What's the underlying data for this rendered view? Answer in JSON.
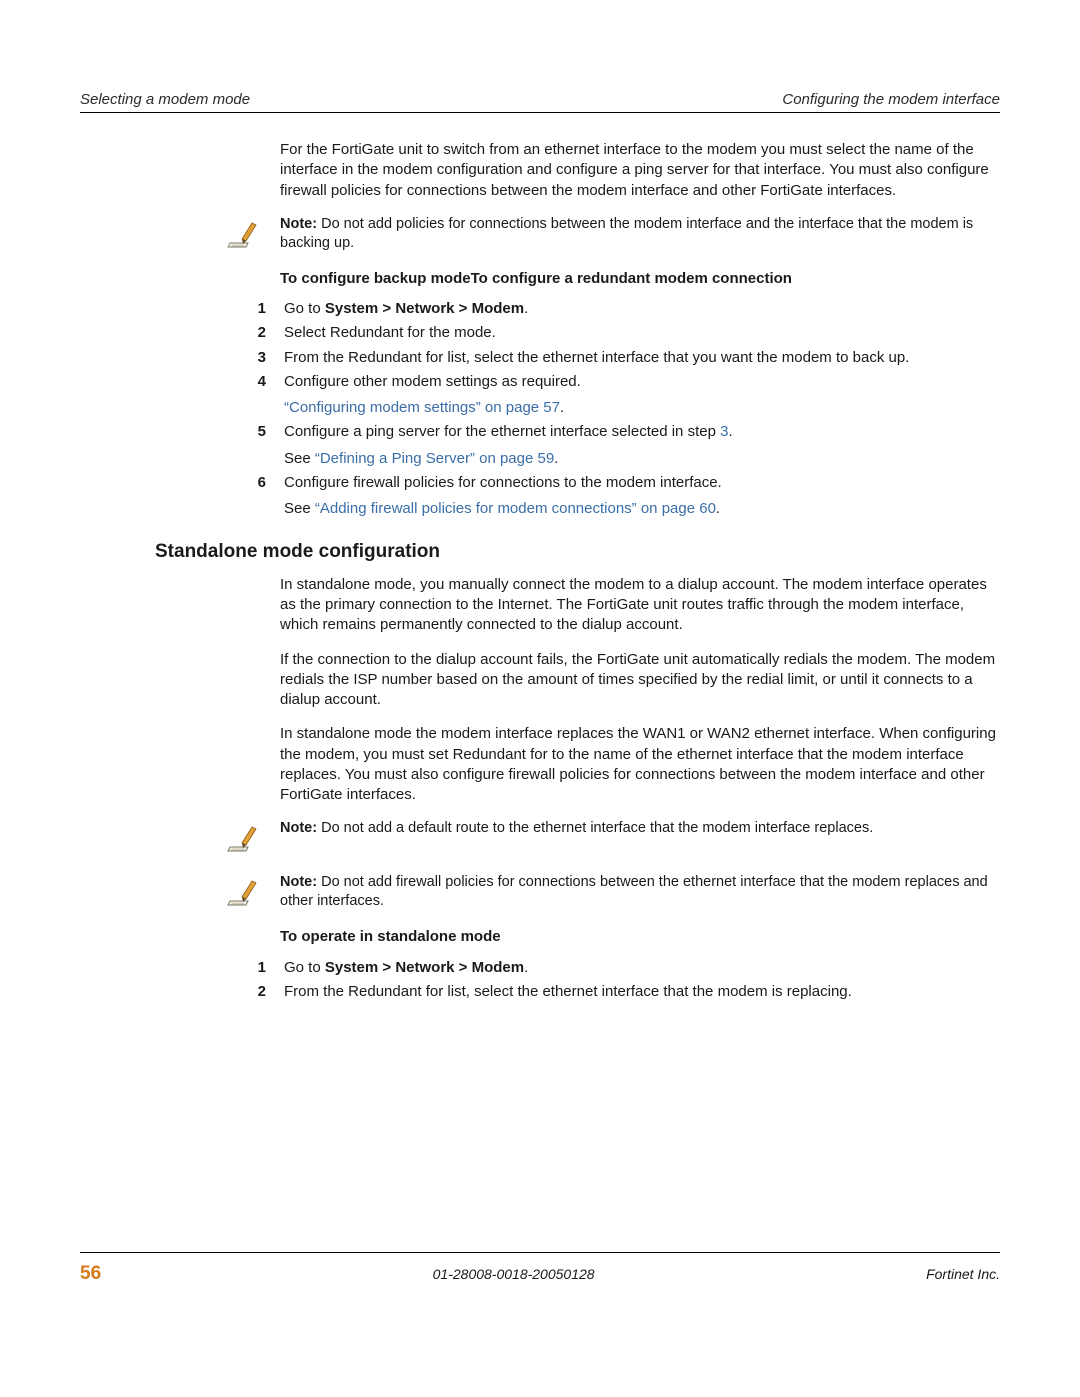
{
  "header": {
    "left": "Selecting a modem mode",
    "right": "Configuring the modem interface"
  },
  "intro": "For the FortiGate unit to switch from an ethernet interface to the modem you must select the name of the interface in the modem configuration and configure a ping server for that interface. You must also configure firewall policies for connections between the modem interface and other FortiGate interfaces.",
  "note1": {
    "label": "Note:",
    "text": " Do not add policies for connections between the modem interface and the interface that the modem is backing up."
  },
  "proc1": {
    "title": "To configure backup modeTo configure a redundant modem connection",
    "steps": [
      {
        "n": "1",
        "pre": "Go to ",
        "bold": "System > Network > Modem",
        "post": "."
      },
      {
        "n": "2",
        "text": "Select Redundant for the mode."
      },
      {
        "n": "3",
        "text": "From the Redundant for list, select the ethernet interface that you want the modem to back up."
      },
      {
        "n": "4",
        "text": "Configure other modem settings as required.",
        "sub_link": "“Configuring modem settings” on page 57",
        "sub_post": "."
      },
      {
        "n": "5",
        "pre": "Configure a ping server for the ethernet interface selected in step ",
        "link_inline": "3",
        "post": ".",
        "sub_pre": "See ",
        "sub_link": "“Defining a Ping Server” on page 59",
        "sub_post": "."
      },
      {
        "n": "6",
        "text": "Configure firewall policies for connections to the modem interface.",
        "sub_pre": "See ",
        "sub_link": "“Adding firewall policies for modem connections” on page 60",
        "sub_post": "."
      }
    ]
  },
  "section2": {
    "heading": "Standalone mode configuration",
    "p1": "In standalone mode, you manually connect the modem to a dialup account. The modem interface operates as the primary connection to the Internet. The FortiGate unit routes traffic through the modem interface, which remains permanently connected to the dialup account.",
    "p2": "If the connection to the dialup account fails, the FortiGate unit automatically redials the modem. The modem redials the ISP number based on the amount of times specified by the redial limit, or until it connects to a dialup account.",
    "p3": "In standalone mode the modem interface replaces the WAN1 or WAN2 ethernet interface. When configuring the modem, you must set Redundant for to the name of the ethernet interface that the modem interface replaces. You must also configure firewall policies for connections between the modem interface and other FortiGate interfaces."
  },
  "note2": {
    "label": "Note:",
    "text": " Do not add a default route to the ethernet interface that the modem interface replaces."
  },
  "note3": {
    "label": "Note:",
    "text": " Do not add firewall policies for connections between the ethernet interface that the modem replaces and other interfaces."
  },
  "proc2": {
    "title": "To operate in standalone mode",
    "steps": [
      {
        "n": "1",
        "pre": "Go to ",
        "bold": "System > Network > Modem",
        "post": "."
      },
      {
        "n": "2",
        "text": "From the Redundant for list, select the ethernet interface that the modem is replacing."
      }
    ]
  },
  "footer": {
    "page": "56",
    "docid": "01-28008-0018-20050128",
    "company": "Fortinet Inc."
  }
}
